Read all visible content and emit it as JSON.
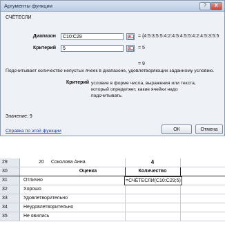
{
  "dialog": {
    "title": "Аргументы функции",
    "help_button": "?",
    "close_button": "X",
    "function_name": "СЧЁТЕСЛИ",
    "args": [
      {
        "label": "Диапазон",
        "value": "C10:C29",
        "result": "= {4:5:3:5:5:4:2:4:5:4:5:5:4:2:4:5:3:5:5"
      },
      {
        "label": "Критерий",
        "value": "5",
        "result": "= 5"
      }
    ],
    "formula_result": "= 9",
    "description": "Подсчитывает количество непустых ячеек в диапазоне, удовлетворяющих заданному условию.",
    "arg_help_label": "Критерий",
    "arg_help_text": "условие в форме числа, выражения или текста, который определяет, какие ячейки надо подсчитывать.",
    "value_line": "Значение: 9",
    "help_link": "Справка по этой функции",
    "ok_label": "ОК",
    "cancel_label": "Отмена"
  },
  "sheet": {
    "rows": [
      {
        "num": "29",
        "b": "20",
        "c": "Соколова Анна",
        "d": "4"
      },
      {
        "num": "30",
        "b": "",
        "c": "Оценка",
        "d": "Количество"
      },
      {
        "num": "31",
        "b": "",
        "c": "Отлично",
        "d": "=СЧЁТЕСЛИ(C10:C29;5)"
      },
      {
        "num": "32",
        "b": "",
        "c": "Хорошо",
        "d": ""
      },
      {
        "num": "33",
        "b": "",
        "c": "Удовлетворительно",
        "d": ""
      },
      {
        "num": "34",
        "b": "",
        "c": "Неудовлетворительно",
        "d": ""
      },
      {
        "num": "35",
        "b": "",
        "c": "Не явились",
        "d": ""
      }
    ]
  }
}
